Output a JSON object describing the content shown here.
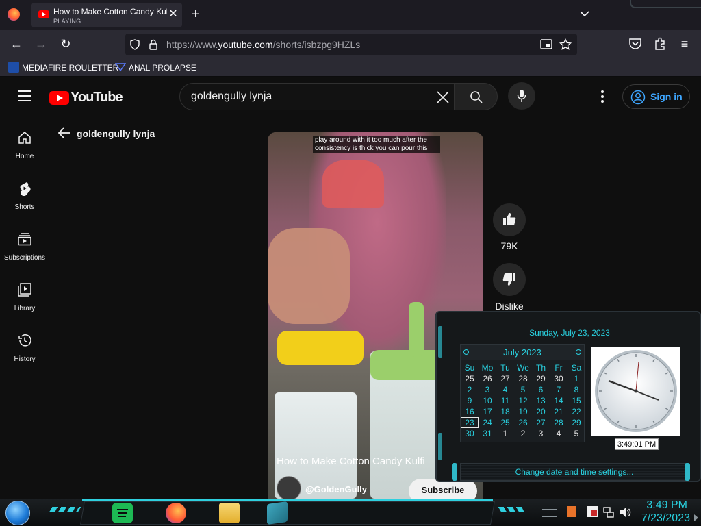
{
  "browser": {
    "tab": {
      "title": "How to Make Cotton Candy Kulfi",
      "status": "PLAYING"
    },
    "url": {
      "prefix": "https://www.",
      "host": "youtube.com",
      "path": "/shorts/isbzpg9HZLs"
    },
    "bookmarks": [
      {
        "label": "MEDIAFIRE ROULETTER"
      },
      {
        "label": "ANAL PROLAPSE"
      }
    ]
  },
  "youtube": {
    "logo_text": "YouTube",
    "search": {
      "value": "goldengully lynja"
    },
    "signin_label": "Sign in",
    "nav": [
      {
        "label": "Home",
        "icon": "home-icon"
      },
      {
        "label": "Shorts",
        "icon": "shorts-icon"
      },
      {
        "label": "Subscriptions",
        "icon": "subscriptions-icon"
      },
      {
        "label": "Library",
        "icon": "library-icon"
      },
      {
        "label": "History",
        "icon": "history-icon"
      }
    ],
    "page_title": "goldengully lynja",
    "short": {
      "caption": "play around with it too much after the consistency is thick you can pour this",
      "title": "How to Make Cotton Candy Kulfi",
      "channel": "@GoldenGully",
      "subscribe_label": "Subscribe",
      "likes": "79K",
      "dislike_label": "Dislike"
    }
  },
  "clock_popup": {
    "date_long": "Sunday, July 23, 2023",
    "calendar": {
      "month_label": "July 2023",
      "weekdays": [
        "Su",
        "Mo",
        "Tu",
        "We",
        "Th",
        "Fr",
        "Sa"
      ],
      "weeks": [
        [
          "25",
          "26",
          "27",
          "28",
          "29",
          "30",
          "1"
        ],
        [
          "2",
          "3",
          "4",
          "5",
          "6",
          "7",
          "8"
        ],
        [
          "9",
          "10",
          "11",
          "12",
          "13",
          "14",
          "15"
        ],
        [
          "16",
          "17",
          "18",
          "19",
          "20",
          "21",
          "22"
        ],
        [
          "23",
          "24",
          "25",
          "26",
          "27",
          "28",
          "29"
        ],
        [
          "30",
          "31",
          "1",
          "2",
          "3",
          "4",
          "5"
        ]
      ],
      "today": "23"
    },
    "digital_time": "3:49:01 PM",
    "change_settings_label": "Change date and time settings..."
  },
  "taskbar": {
    "time": "3:49 PM",
    "date": "7/23/2023"
  },
  "colors": {
    "accent": "#29d0df",
    "yt_red": "#ff0000",
    "link_blue": "#3ea6ff"
  }
}
